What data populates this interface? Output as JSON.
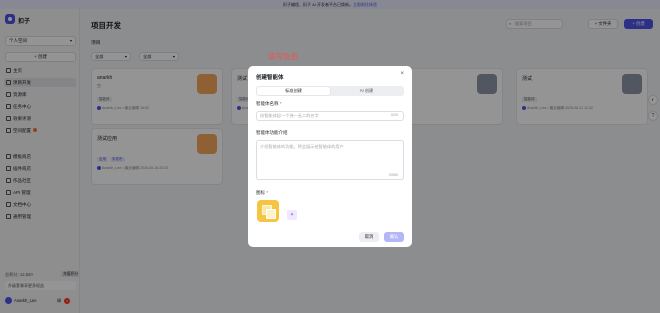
{
  "banner": {
    "text": "扣子编程、扣子 AI 开发者平台已焕新。",
    "link": "立即前往体验"
  },
  "sidebar": {
    "brand": "扣子",
    "space": "个人空间",
    "create_label": "+ 创建",
    "nav_primary": [
      {
        "label": "主页",
        "icon": "home-icon"
      },
      {
        "label": "项目开发",
        "icon": "project-icon",
        "active": true
      },
      {
        "label": "资源库",
        "icon": "library-icon"
      },
      {
        "label": "任务中心",
        "icon": "task-icon"
      },
      {
        "label": "效果评测",
        "icon": "evaluate-icon"
      },
      {
        "label": "空间配置",
        "icon": "settings-icon",
        "badge": true
      }
    ],
    "nav_secondary": [
      {
        "label": "模板商店",
        "icon": "template-icon"
      },
      {
        "label": "插件商店",
        "icon": "plugin-icon"
      },
      {
        "label": "作品社区",
        "icon": "community-icon"
      },
      {
        "label": "API 管理",
        "icon": "api-icon"
      },
      {
        "label": "文档中心",
        "icon": "doc-icon"
      },
      {
        "label": "通用管理",
        "icon": "manage-icon"
      }
    ],
    "credit_label": "总积分: 12,620",
    "credit_tag": "充值积分",
    "credit_box": "升级套餐享更多权益",
    "user": "Anarkh_Lee",
    "notif_count": "2"
  },
  "main": {
    "title": "项目开发",
    "search_placeholder": "搜索项目",
    "folder_btn": "+ 文件夹",
    "new_btn": "+ 创建",
    "section": "项目",
    "filter1": "全部",
    "filter2": "全部",
    "cards": [
      {
        "name": "anarkh",
        "desc": "空",
        "tags": [
          "智能体"
        ],
        "meta": "Anarkh_Lee • 最近编辑 16:02"
      },
      {
        "name": "测试",
        "desc": "",
        "tags": [
          "智能体"
        ],
        "meta": "Anarkh_Lee • 最近编辑 2025-06-11 11:22"
      },
      {
        "name": "测试",
        "desc": "",
        "tags": [
          "智能体"
        ],
        "meta": "Anarkh_Lee • 最近编辑 2025-06-11 11:22"
      },
      {
        "name": "测试应用",
        "desc": "",
        "tags": [
          "应用",
          "未发布"
        ],
        "meta": "Anarkh_Lee • 最近编辑 2025-05-16 20:22"
      }
    ]
  },
  "annotation": "填写信息",
  "modal": {
    "title": "创建智能体",
    "tab_standard": "标准创建",
    "tab_ai": "AI 创建",
    "name_label": "智能体名称",
    "name_placeholder": "给智能体起一个独一无二的名字",
    "name_counter": "0/20",
    "desc_label": "智能体功能介绍",
    "desc_placeholder": "介绍智能体的功能，将会展示给智能体的用户",
    "desc_counter": "0/500",
    "icon_label": "图标",
    "cancel": "取消",
    "ok": "确认"
  },
  "colors": {
    "accent": "#4d53e8",
    "annotation": "#f05252"
  }
}
